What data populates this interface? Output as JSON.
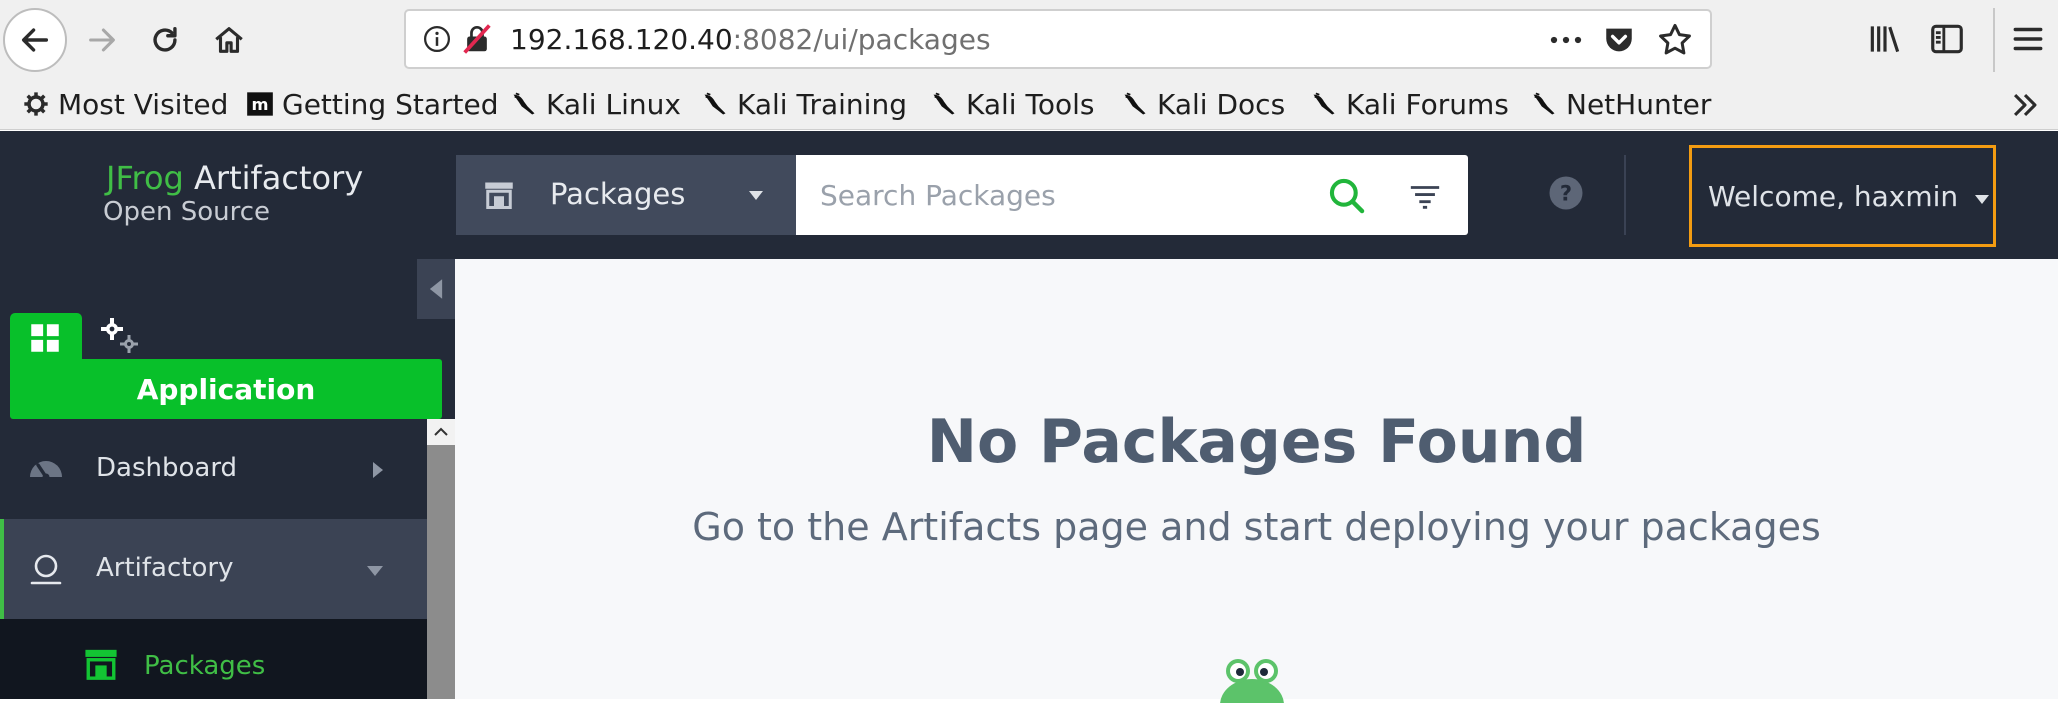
{
  "browser": {
    "url_host": "192.168.120.40",
    "url_rest": ":8082/ui/packages",
    "bookmarks": [
      {
        "label": "Most Visited",
        "icon": "gear-icon"
      },
      {
        "label": "Getting Started",
        "icon": "mozilla-m-icon"
      },
      {
        "label": "Kali Linux",
        "icon": "kali-dragon-icon"
      },
      {
        "label": "Kali Training",
        "icon": "kali-dragon-icon"
      },
      {
        "label": "Kali Tools",
        "icon": "kali-dragon-icon"
      },
      {
        "label": "Kali Docs",
        "icon": "kali-dragon-icon"
      },
      {
        "label": "Kali Forums",
        "icon": "kali-dragon-icon"
      },
      {
        "label": "NetHunter",
        "icon": "kali-dragon-icon"
      }
    ]
  },
  "header": {
    "logo_brand": "JFrog",
    "logo_product": " Artifactory",
    "logo_edition": "Open Source",
    "package_selector": "Packages",
    "search_placeholder": "Search Packages",
    "welcome": "Welcome, haxmin"
  },
  "sidebar": {
    "banner": "Application",
    "items": [
      {
        "label": "Dashboard",
        "icon": "gauge-icon"
      },
      {
        "label": "Artifactory",
        "icon": "artifactory-icon"
      }
    ],
    "sub_items": [
      {
        "label": "Packages",
        "icon": "packages-icon"
      }
    ]
  },
  "main": {
    "title": "No Packages Found",
    "subtitle": "Go to the Artifacts page and start deploying your packages"
  },
  "colors": {
    "header_bg": "#232a38",
    "accent_green": "#40be46",
    "app_banner_green": "#08c02a",
    "highlight_orange": "#f39c12"
  }
}
